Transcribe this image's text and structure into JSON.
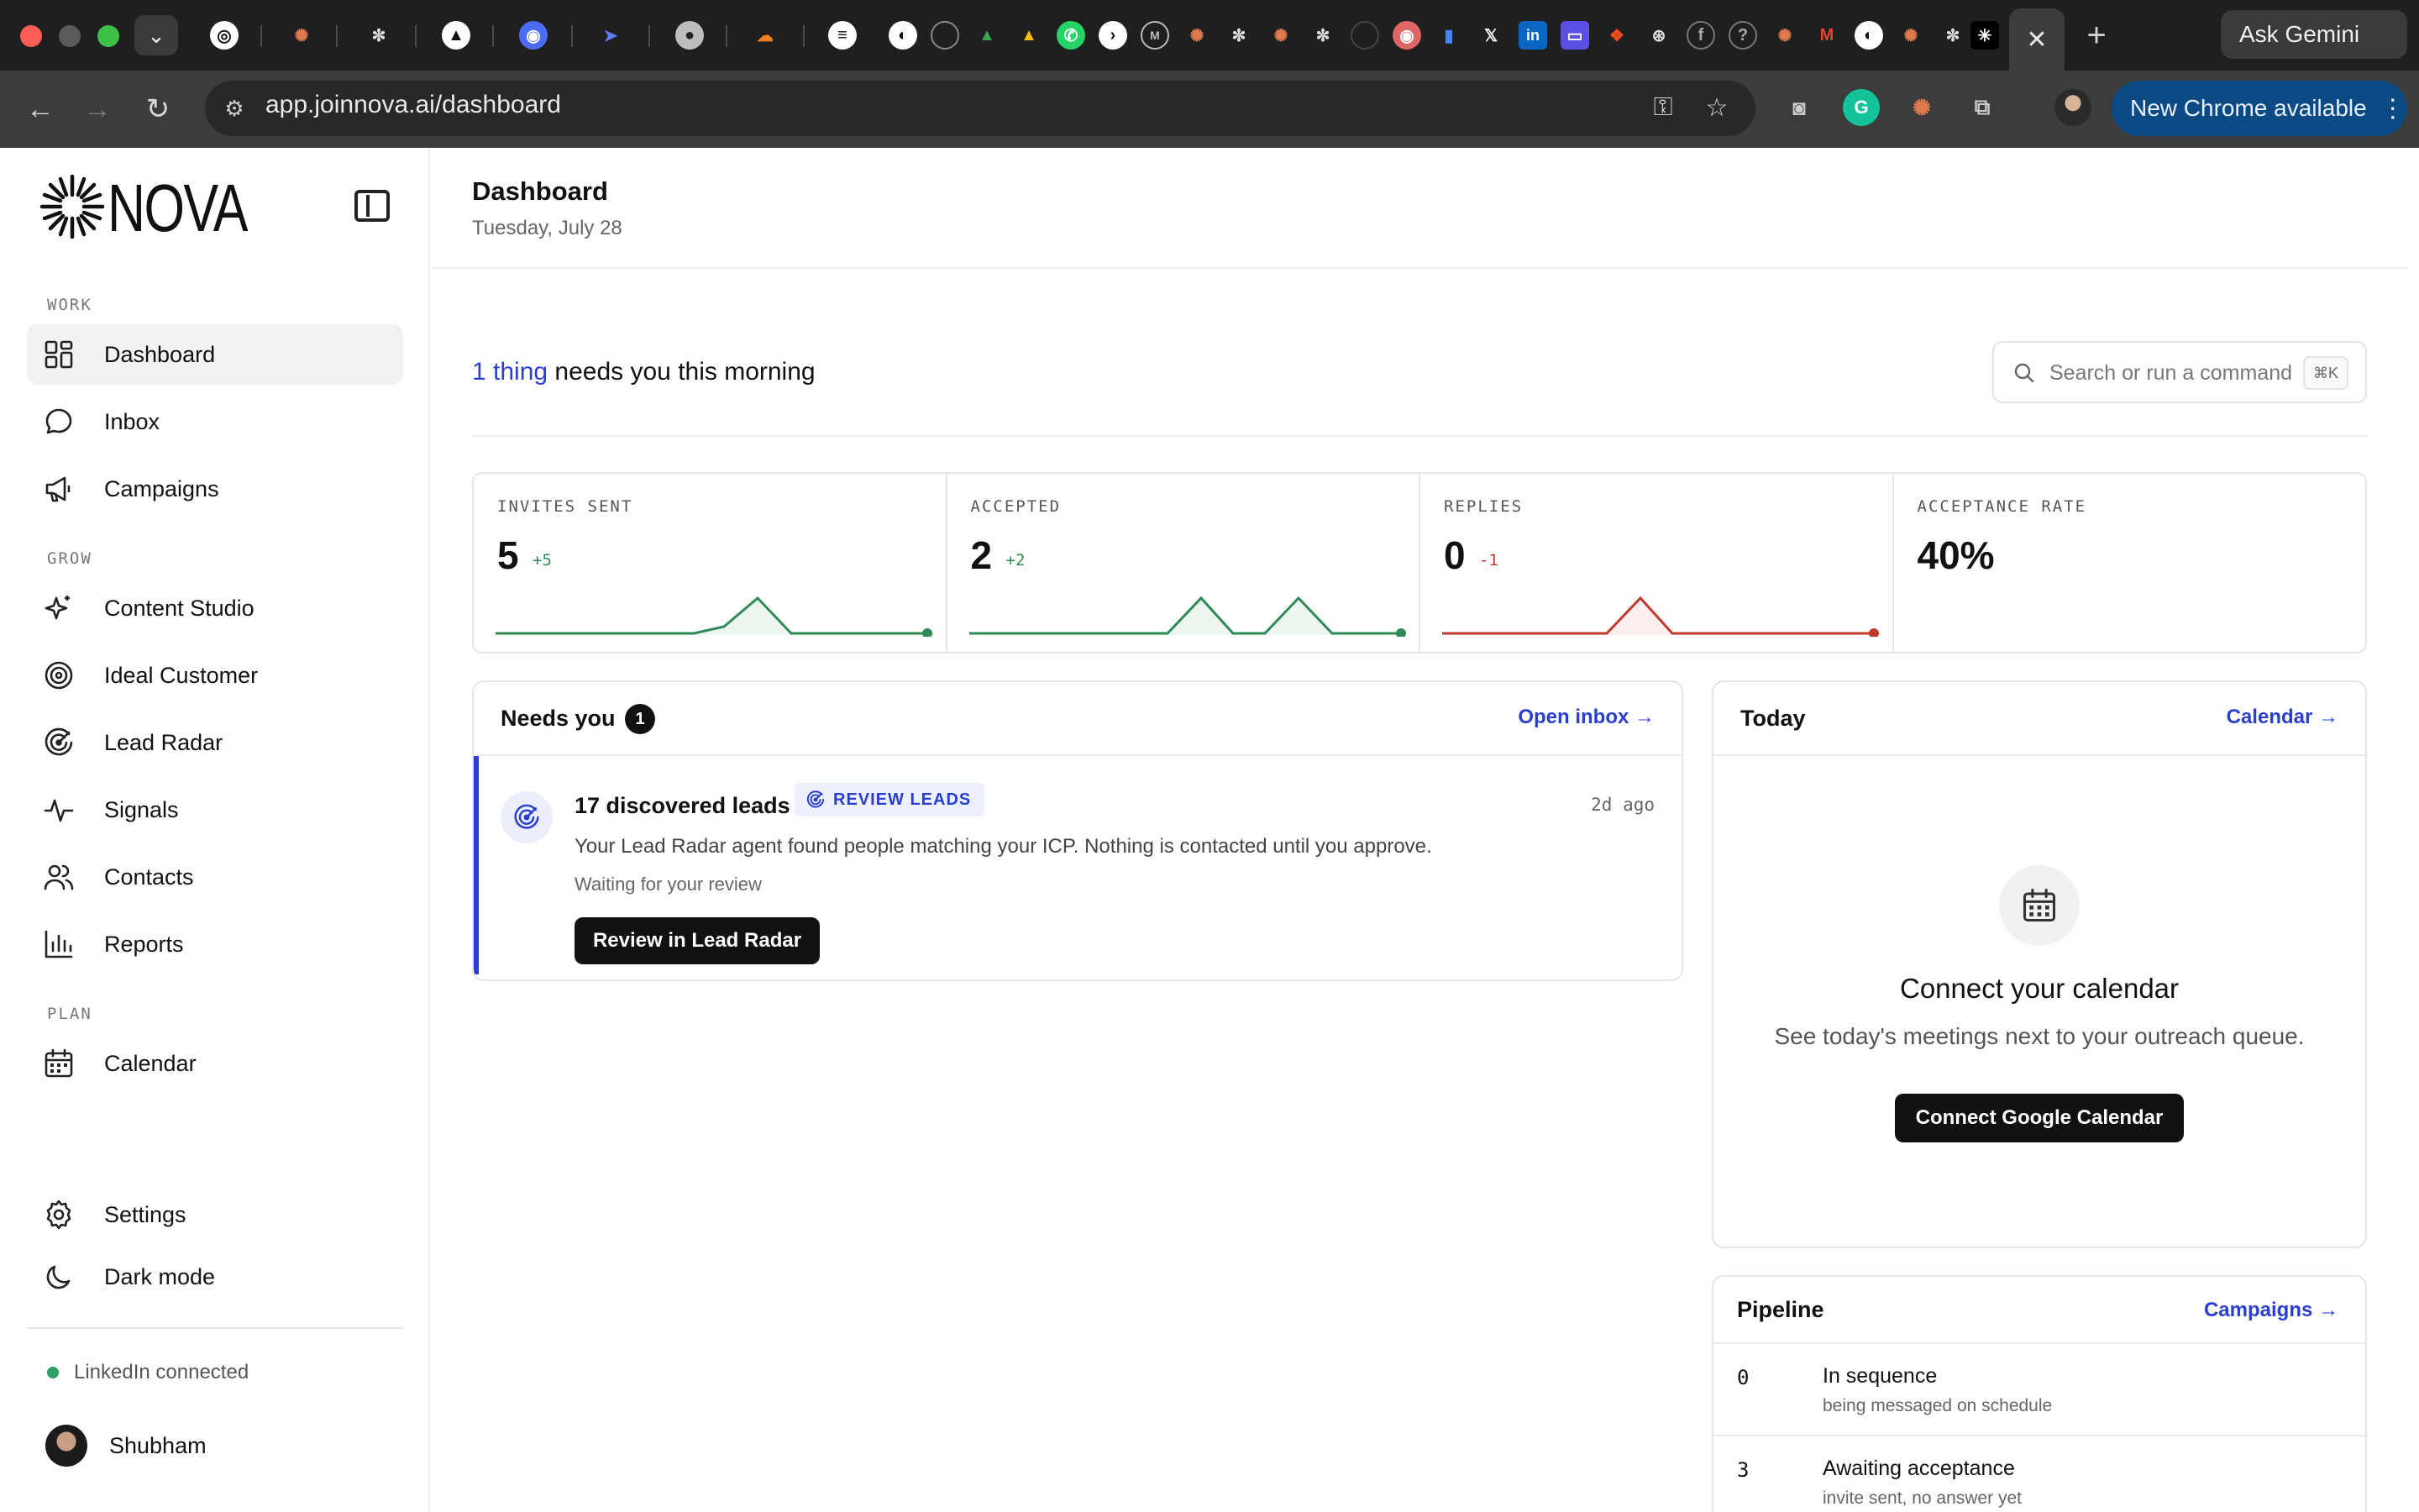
{
  "browser": {
    "url": "app.joinnova.ai/dashboard",
    "gemini_label": "Ask Gemini",
    "update_label": "New Chrome available"
  },
  "sidebar": {
    "logo": "NOVA",
    "sections": {
      "work": "WORK",
      "grow": "GROW",
      "plan": "PLAN"
    },
    "items": {
      "dashboard": "Dashboard",
      "inbox": "Inbox",
      "campaigns": "Campaigns",
      "content_studio": "Content Studio",
      "ideal_customer": "Ideal Customer",
      "lead_radar": "Lead Radar",
      "signals": "Signals",
      "contacts": "Contacts",
      "reports": "Reports",
      "calendar": "Calendar",
      "settings": "Settings",
      "dark_mode": "Dark mode"
    },
    "linkedin_status": "LinkedIn connected",
    "user_name": "Shubham"
  },
  "header": {
    "title": "Dashboard",
    "date": "Tuesday, July 28"
  },
  "headline": {
    "highlight": "1 thing",
    "rest": " needs you this morning"
  },
  "search": {
    "placeholder": "Search or run a command",
    "shortcut": "⌘K"
  },
  "stats": [
    {
      "label": "INVITES SENT",
      "value": "5",
      "delta": "+5"
    },
    {
      "label": "ACCEPTED",
      "value": "2",
      "delta": "+2"
    },
    {
      "label": "REPLIES",
      "value": "0",
      "delta": "-1"
    },
    {
      "label": "ACCEPTANCE RATE",
      "value": "40%"
    }
  ],
  "needs_you": {
    "title": "Needs you",
    "count": "1",
    "link": "Open inbox →",
    "item": {
      "title": "17 discovered leads",
      "tag": "REVIEW LEADS",
      "time": "2d ago",
      "description": "Your Lead Radar agent found people matching your ICP. Nothing is contacted until you approve.",
      "status": "Waiting for your review",
      "button": "Review in Lead Radar"
    }
  },
  "today": {
    "title": "Today",
    "link": "Calendar →",
    "empty_title": "Connect your calendar",
    "empty_sub": "See today's meetings next to your outreach queue.",
    "button": "Connect Google Calendar"
  },
  "pipeline": {
    "title": "Pipeline",
    "link": "Campaigns →",
    "rows": [
      {
        "count": "0",
        "label": "In sequence",
        "sub": "being messaged on schedule"
      },
      {
        "count": "3",
        "label": "Awaiting acceptance",
        "sub": "invite sent, no answer yet"
      }
    ]
  },
  "colors": {
    "accent": "#2a3fd0",
    "positive": "#2f8a55",
    "negative": "#c0392b"
  }
}
